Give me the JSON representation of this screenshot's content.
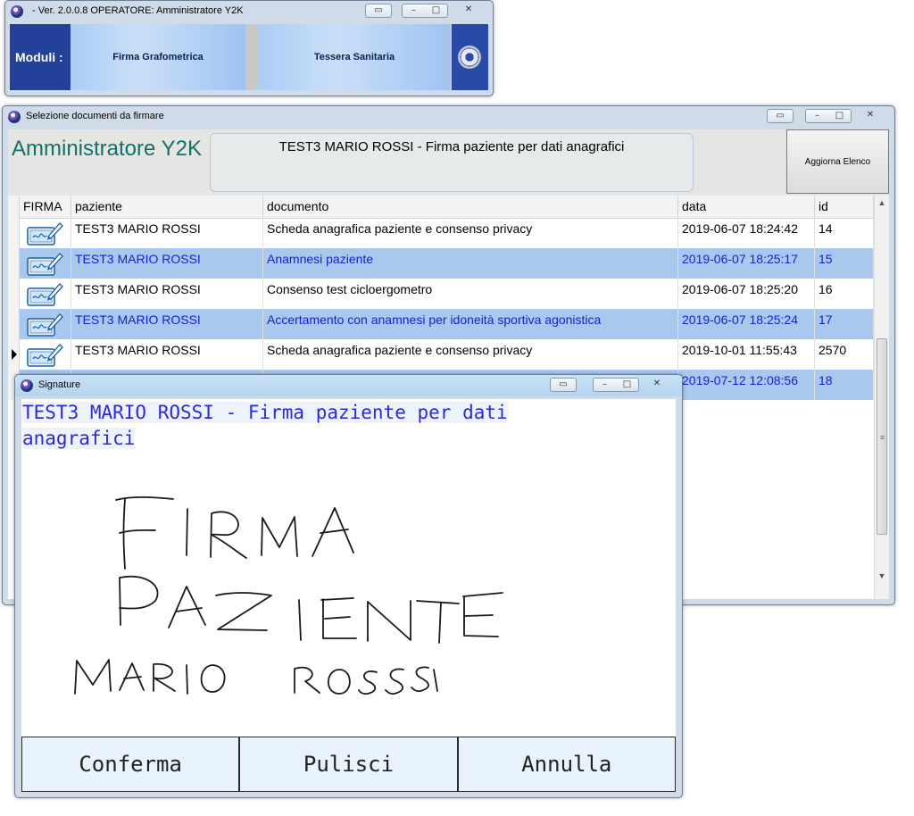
{
  "app_window": {
    "title": "- Ver. 2.0.0.8    OPERATORE: Amministratore Y2K",
    "modules_label": "Moduli :",
    "modules": [
      {
        "label": "Firma Grafometrica"
      },
      {
        "label": "Tessera Sanitaria"
      }
    ],
    "settings_icon": "gear-icon"
  },
  "selection_window": {
    "title": "Selezione documenti da firmare",
    "operator_name": "Amministratore Y2K",
    "current_document": "TEST3 MARIO ROSSI - Firma paziente per dati anagrafici",
    "refresh_label": "Aggiorna Elenco",
    "columns": [
      "FIRMA",
      "paziente",
      "documento",
      "data",
      "id"
    ],
    "rows": [
      {
        "paziente": "TEST3 MARIO ROSSI",
        "documento": "Scheda anagrafica paziente e consenso privacy",
        "data": "2019-06-07 18:24:42",
        "id": "14"
      },
      {
        "paziente": "TEST3 MARIO ROSSI",
        "documento": "Anamnesi paziente",
        "data": "2019-06-07 18:25:17",
        "id": "15"
      },
      {
        "paziente": "TEST3 MARIO ROSSI",
        "documento": "Consenso test cicloergometro",
        "data": "2019-06-07 18:25:20",
        "id": "16"
      },
      {
        "paziente": "TEST3 MARIO ROSSI",
        "documento": "Accertamento con anamnesi per idoneità sportiva agonistica",
        "data": "2019-06-07 18:25:24",
        "id": "17"
      },
      {
        "paziente": "TEST3 MARIO ROSSI",
        "documento": "Scheda anagrafica paziente e consenso privacy",
        "data": "2019-10-01 11:55:43",
        "id": "2570"
      },
      {
        "paziente": "",
        "documento": "",
        "data": "2019-07-12 12:08:56",
        "id": "18"
      }
    ],
    "selected_row_index": 4
  },
  "signature_window": {
    "title": "Signature",
    "prompt": "TEST3 MARIO ROSSI - Firma paziente per dati anagrafici",
    "handwritten_lines": [
      "FIRMA",
      "PAZIENTE",
      "MARIO ROSSI"
    ],
    "buttons": {
      "confirm": "Conferma",
      "clear": "Pulisci",
      "cancel": "Annulla"
    }
  },
  "colors": {
    "module_bar_dark": "#24419a",
    "row_highlight": "#a9c8ee",
    "highlight_text": "#1c1ccc",
    "operator_text": "#12706a"
  }
}
